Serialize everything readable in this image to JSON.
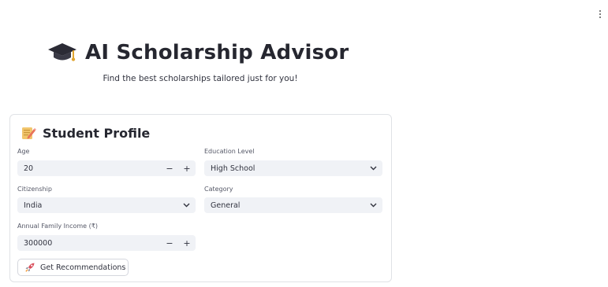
{
  "header": {
    "title": "AI Scholarship Advisor",
    "subtitle": "Find the best scholarships tailored just for you!",
    "title_icon": "graduation-cap-icon"
  },
  "profile": {
    "section_title": "Student Profile",
    "section_icon": "memo-icon",
    "fields": {
      "age": {
        "label": "Age",
        "value": "20",
        "dec": "−",
        "inc": "+"
      },
      "education_level": {
        "label": "Education Level",
        "value": "High School"
      },
      "citizenship": {
        "label": "Citizenship",
        "value": "India"
      },
      "category": {
        "label": "Category",
        "value": "General"
      },
      "income": {
        "label": "Annual Family Income (₹)",
        "value": "300000",
        "dec": "−",
        "inc": "+"
      }
    },
    "submit_label": "Get Recommendations",
    "submit_icon": "rocket-icon"
  },
  "colors": {
    "field_bg": "#f0f2f6",
    "border": "#e0e2e6",
    "text": "#31333f"
  }
}
